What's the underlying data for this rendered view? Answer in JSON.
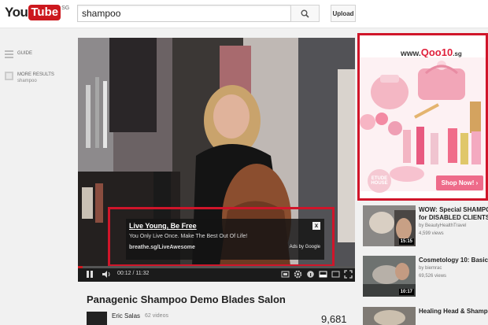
{
  "header": {
    "logo_you": "You",
    "logo_tube": "Tube",
    "logo_region": "SG",
    "search_value": "shampoo",
    "upload_label": "Upload"
  },
  "guide": {
    "guide_label": "GUIDE",
    "more_results_label": "MORE RESULTS",
    "more_results_query": "shampoo"
  },
  "player": {
    "progress": 0.018,
    "current_time": "00:12",
    "duration": "11:32",
    "overlay_ad": {
      "title": "Live Young, Be Free",
      "description": "You Only Live Once. Make The Best Out Of Life!",
      "url": "breathe.sg/LiveAwesome",
      "ads_by": "Ads by Google",
      "close": "x"
    }
  },
  "video": {
    "title": "Panagenic Shampoo Demo Blades Salon",
    "channel": "Eric Salas",
    "video_count": "62 videos",
    "views": "9,681"
  },
  "banner": {
    "brand_prefix": "www.",
    "brand_name": "Qoo10",
    "brand_suffix": ".sg",
    "etude_label": "ETUDE HOUSE",
    "shop_now_label": "Shop Now! ›"
  },
  "related": [
    {
      "title": "WOW: Special SHAMPOO",
      "subtitle": "for DISABLED CLIENTS;",
      "channel": "by BeautyHealthTravel",
      "views": "4,599 views",
      "duration": "15:15"
    },
    {
      "title": "Cosmetology 10: Basic Sh",
      "subtitle": "",
      "channel": "by biemrac",
      "views": "69,526 views",
      "duration": "10:17"
    },
    {
      "title": "Healing Head & Shampoo",
      "subtitle": "",
      "channel": "",
      "views": "",
      "duration": ""
    }
  ],
  "colors": {
    "brand_red": "#cc181e",
    "highlight_red": "#d0152a",
    "shop_pink": "#ee6b8a"
  }
}
